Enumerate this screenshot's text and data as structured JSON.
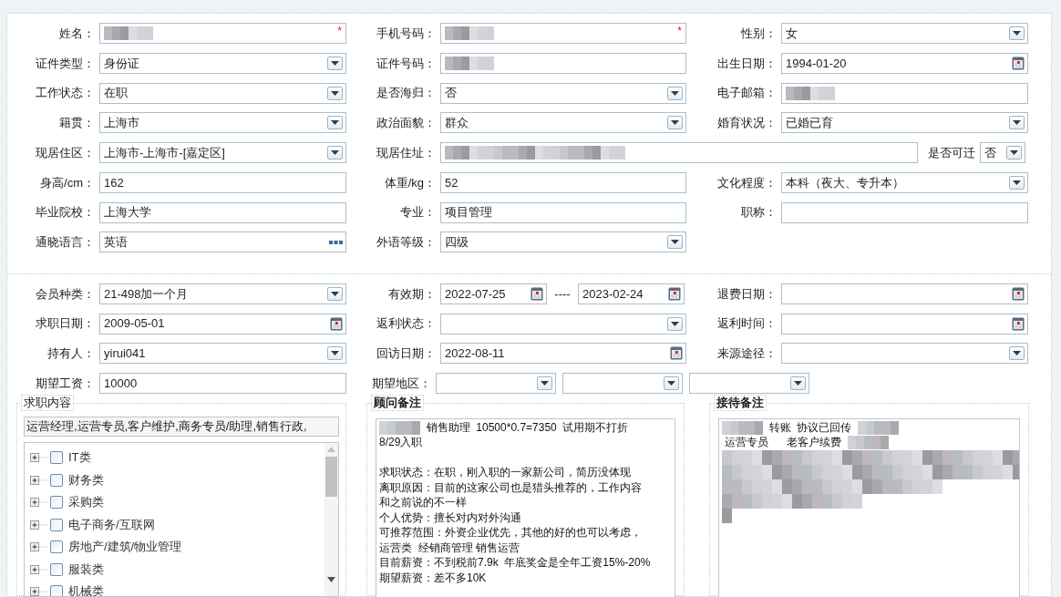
{
  "personal": {
    "rows": [
      [
        {
          "label": "姓名：",
          "kind": "text",
          "redacted": true,
          "required_mark": "*"
        },
        {
          "label": "手机号码：",
          "kind": "text",
          "redacted": true,
          "required_mark": "*"
        },
        {
          "label": "性别：",
          "kind": "select",
          "value": "女"
        }
      ],
      [
        {
          "label": "证件类型：",
          "kind": "select",
          "value": "身份证"
        },
        {
          "label": "证件号码：",
          "kind": "text",
          "redacted": true
        },
        {
          "label": "出生日期：",
          "kind": "date",
          "value": "1994-01-20"
        }
      ],
      [
        {
          "label": "工作状态：",
          "kind": "select",
          "value": "在职"
        },
        {
          "label": "是否海归：",
          "kind": "select",
          "value": "否"
        },
        {
          "label": "电子邮箱：",
          "kind": "text",
          "redacted": true
        }
      ],
      [
        {
          "label": "籍贯：",
          "kind": "select",
          "value": "上海市"
        },
        {
          "label": "政治面貌：",
          "kind": "select",
          "value": "群众"
        },
        {
          "label": "婚育状况：",
          "kind": "select",
          "value": "已婚已育"
        }
      ],
      [
        {
          "label": "现居住区：",
          "kind": "select",
          "value": "上海市-上海市-[嘉定区]"
        },
        {
          "label": "现居住址：",
          "kind": "address",
          "redacted": true,
          "relocate_label": "是否可迁",
          "relocate_value": "否"
        }
      ],
      [
        {
          "label": "身高/cm：",
          "kind": "text",
          "value": "162"
        },
        {
          "label": "体重/kg：",
          "kind": "text",
          "value": "52"
        },
        {
          "label": "文化程度：",
          "kind": "select",
          "value": "本科（夜大、专升本）"
        }
      ],
      [
        {
          "label": "毕业院校：",
          "kind": "text",
          "value": "上海大学"
        },
        {
          "label": "专业：",
          "kind": "text",
          "value": "项目管理"
        },
        {
          "label": "职称：",
          "kind": "text"
        }
      ],
      [
        {
          "label": "通晓语言：",
          "kind": "lookup",
          "value": "英语"
        },
        {
          "label": "外语等级：",
          "kind": "select",
          "value": "四级"
        }
      ]
    ]
  },
  "membership": {
    "rows": [
      [
        {
          "label": "会员种类：",
          "kind": "select",
          "value": "21-498加一个月"
        },
        {
          "label": "有效期：",
          "kind": "date_range",
          "value": "2022-07-25",
          "separator": "----",
          "end_value": "2023-02-24"
        },
        {
          "label": "退费日期：",
          "kind": "date"
        }
      ],
      [
        {
          "label": "求职日期：",
          "kind": "date",
          "value": "2009-05-01"
        },
        {
          "label": "返利状态：",
          "kind": "select"
        },
        {
          "label": "返利时间：",
          "kind": "date"
        }
      ],
      [
        {
          "label": "持有人：",
          "kind": "select",
          "value": "yirui041"
        },
        {
          "label": "回访日期：",
          "kind": "date",
          "value": "2022-08-11"
        },
        {
          "label": "来源途径：",
          "kind": "select"
        }
      ],
      [
        {
          "label": "期望工资：",
          "kind": "text",
          "value": "10000"
        },
        {
          "label": "期望地区：",
          "kind": "region"
        }
      ]
    ]
  },
  "job_content": {
    "title": "求职内容",
    "selected_text": "运营经理,运营专员,客户维护,商务专员/助理,销售行政,",
    "categories": [
      {
        "label": "IT类",
        "checked": false,
        "expanded": false
      },
      {
        "label": "财务类",
        "checked": false,
        "expanded": false
      },
      {
        "label": "采购类",
        "checked": false,
        "expanded": false
      },
      {
        "label": "电子商务/互联网",
        "checked": false,
        "expanded": false
      },
      {
        "label": "房地产/建筑/物业管理",
        "checked": false,
        "expanded": false
      },
      {
        "label": "服装类",
        "checked": false,
        "expanded": false
      },
      {
        "label": "机械类",
        "checked": false,
        "expanded": false
      }
    ]
  },
  "consultant_notes": {
    "title": "顾问备注",
    "lines": [
      [
        {
          "kind": "redacted"
        },
        {
          "kind": "text",
          "text": "  销售助理  10500*0.7=7350  试用期不打折"
        }
      ],
      [
        {
          "kind": "text",
          "text": "8/29入职"
        }
      ],
      [
        {
          "kind": "blank"
        }
      ],
      [
        {
          "kind": "text",
          "text": "求职状态：在职，刚入职的一家新公司，简历没体现"
        }
      ],
      [
        {
          "kind": "text",
          "text": "离职原因：目前的这家公司也是猎头推荐的，工作内容"
        }
      ],
      [
        {
          "kind": "text",
          "text": "和之前说的不一样"
        }
      ],
      [
        {
          "kind": "text",
          "text": "个人优势：擅长对内对外沟通"
        }
      ],
      [
        {
          "kind": "text",
          "text": "可推荐范围：外资企业优先，其他的好的也可以考虑，"
        }
      ],
      [
        {
          "kind": "text",
          "text": "运营类  经销商管理 销售运营"
        }
      ],
      [
        {
          "kind": "text",
          "text": "目前薪资：不到税前7.9k  年底奖金是全年工资15%-20%"
        }
      ],
      [
        {
          "kind": "text",
          "text": "期望薪资：差不多10K"
        }
      ]
    ]
  },
  "reception_notes": {
    "title": "接待备注",
    "lines": [
      [
        {
          "kind": "redacted"
        },
        {
          "kind": "text",
          "text": "  转账  协议已回传  "
        },
        {
          "kind": "redacted"
        }
      ],
      [
        {
          "kind": "text",
          "text": " 运营专员      老客户续费  "
        },
        {
          "kind": "redacted"
        }
      ],
      [
        {
          "kind": "redacted_block"
        }
      ]
    ]
  }
}
